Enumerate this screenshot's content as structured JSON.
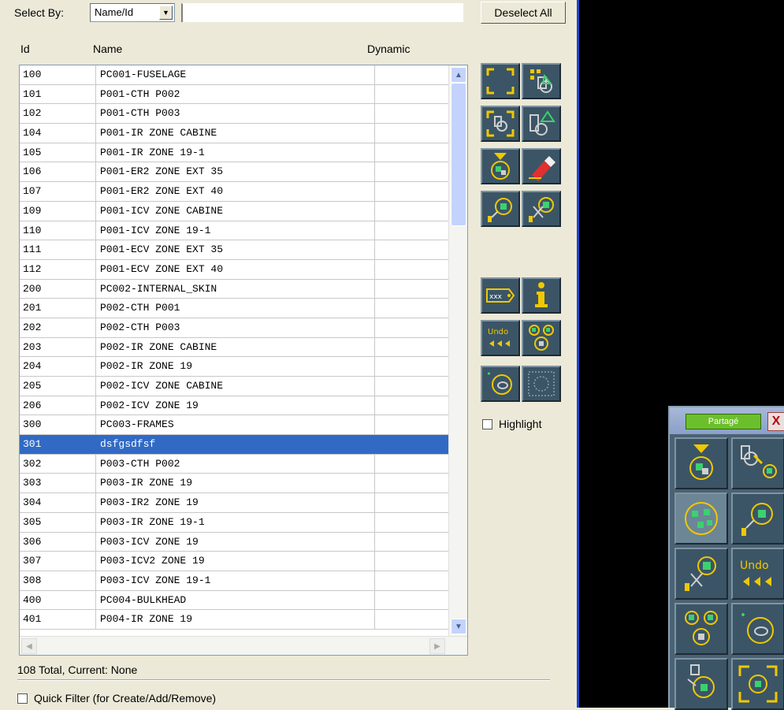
{
  "toolbar": {
    "select_by_label": "Select By:",
    "select_by_value": "Name/Id",
    "deselect_all_label": "Deselect All"
  },
  "columns": {
    "id": "Id",
    "name": "Name",
    "dynamic": "Dynamic"
  },
  "rows": [
    {
      "id": "100",
      "name": "PC001-FUSELAGE"
    },
    {
      "id": "101",
      "name": "P001-CTH P002"
    },
    {
      "id": "102",
      "name": "P001-CTH P003"
    },
    {
      "id": "104",
      "name": "P001-IR ZONE CABINE"
    },
    {
      "id": "105",
      "name": "P001-IR ZONE 19-1"
    },
    {
      "id": "106",
      "name": "P001-ER2 ZONE EXT 35"
    },
    {
      "id": "107",
      "name": "P001-ER2 ZONE EXT 40"
    },
    {
      "id": "109",
      "name": "P001-ICV ZONE CABINE"
    },
    {
      "id": "110",
      "name": "P001-ICV ZONE 19-1"
    },
    {
      "id": "111",
      "name": "P001-ECV ZONE EXT 35"
    },
    {
      "id": "112",
      "name": "P001-ECV ZONE EXT 40"
    },
    {
      "id": "200",
      "name": "PC002-INTERNAL_SKIN"
    },
    {
      "id": "201",
      "name": "P002-CTH P001"
    },
    {
      "id": "202",
      "name": "P002-CTH P003"
    },
    {
      "id": "203",
      "name": "P002-IR ZONE CABINE"
    },
    {
      "id": "204",
      "name": "P002-IR ZONE 19"
    },
    {
      "id": "205",
      "name": "P002-ICV ZONE CABINE"
    },
    {
      "id": "206",
      "name": "P002-ICV ZONE 19"
    },
    {
      "id": "300",
      "name": "PC003-FRAMES"
    },
    {
      "id": "301",
      "name": "dsfgsdfsf",
      "selected": true
    },
    {
      "id": "302",
      "name": "P003-CTH P002"
    },
    {
      "id": "303",
      "name": "P003-IR ZONE 19"
    },
    {
      "id": "304",
      "name": "P003-IR2 ZONE 19"
    },
    {
      "id": "305",
      "name": "P003-IR ZONE 19-1"
    },
    {
      "id": "306",
      "name": "P003-ICV ZONE 19"
    },
    {
      "id": "307",
      "name": "P003-ICV2 ZONE 19"
    },
    {
      "id": "308",
      "name": "P003-ICV ZONE 19-1"
    },
    {
      "id": "400",
      "name": "PC004-BULKHEAD"
    },
    {
      "id": "401",
      "name": "P004-IR ZONE 19"
    }
  ],
  "side_tools": {
    "highlight_label": "Highlight",
    "tag_text": "xxx",
    "undo_text": "Undo"
  },
  "status": {
    "summary": "108 Total, Current: None",
    "quick_filter_label": "Quick Filter (for Create/Add/Remove)"
  },
  "floating_palette": {
    "title": "Partagé",
    "close": "X",
    "undo_text": "Undo"
  },
  "colors": {
    "selection": "#316ac5",
    "viewport": "#000000",
    "tool_icon_yellow": "#f0c800",
    "tool_icon_green": "#3cd070"
  }
}
